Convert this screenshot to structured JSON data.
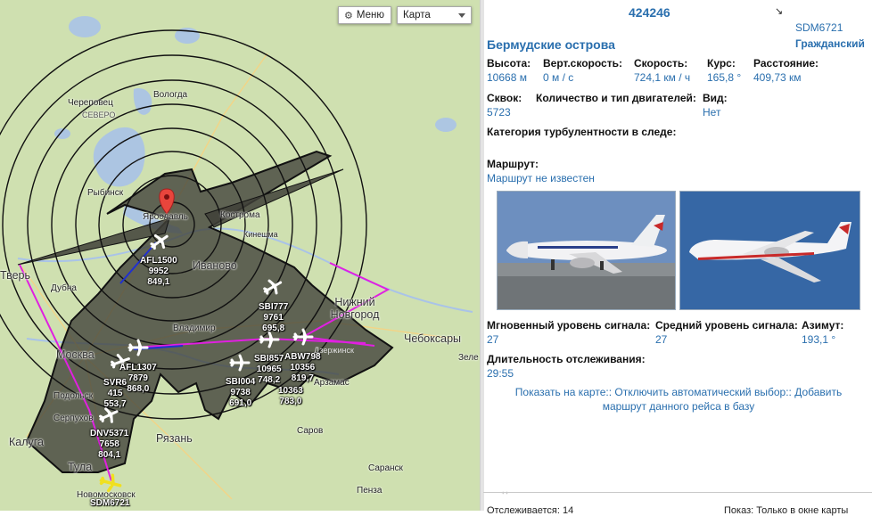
{
  "map": {
    "menu_label": "Меню",
    "layer_value": "Карта",
    "cities": [
      {
        "name": "Вологда",
        "big": false
      },
      {
        "name": "Череповец",
        "big": false
      },
      {
        "name": "СЕВЕРО",
        "big": false
      },
      {
        "name": "Рыбинск",
        "big": false
      },
      {
        "name": "Ярославль",
        "big": false
      },
      {
        "name": "Кострома",
        "big": false
      },
      {
        "name": "Кинешма",
        "big": false
      },
      {
        "name": "Иваново",
        "big": true
      },
      {
        "name": "Тверь",
        "big": true
      },
      {
        "name": "Дубна",
        "big": false
      },
      {
        "name": "Владимир",
        "big": false
      },
      {
        "name": "Нижний Новгород",
        "big": true
      },
      {
        "name": "Чебоксары",
        "big": true
      },
      {
        "name": "Москва",
        "big": true
      },
      {
        "name": "Подольск",
        "big": false
      },
      {
        "name": "Серпухов",
        "big": false
      },
      {
        "name": "Калуга",
        "big": true
      },
      {
        "name": "Тула",
        "big": true
      },
      {
        "name": "Новомосковск",
        "big": false
      },
      {
        "name": "Рязань",
        "big": true
      },
      {
        "name": "Арзамас",
        "big": false
      },
      {
        "name": "Саров",
        "big": false
      },
      {
        "name": "Саранск",
        "big": false
      },
      {
        "name": "Пенза",
        "big": false
      },
      {
        "name": "Зеле",
        "big": false
      },
      {
        "name": "Дзержинск",
        "big": false
      }
    ],
    "flights": [
      {
        "callsign": "AFL1500",
        "altitude": "9952",
        "speed": "849,1"
      },
      {
        "callsign": "SBI777",
        "altitude": "9761",
        "speed": "695,8"
      },
      {
        "callsign": "AFL1307",
        "altitude": "7879",
        "speed": "868,0"
      },
      {
        "callsign": "SVR6",
        "altitude": "415",
        "speed": "553,7"
      },
      {
        "callsign": "SBI857",
        "altitude": "10965",
        "speed": "748,2"
      },
      {
        "callsign": "ABW798",
        "altitude": "10356",
        "speed": "819,7"
      },
      {
        "callsign": "SBI004",
        "altitude": "9738",
        "speed": "691,0"
      },
      {
        "callsign": "",
        "altitude": "10363",
        "speed": "783,0"
      },
      {
        "callsign": "DNV5371",
        "altitude": "7658",
        "speed": "804,1"
      },
      {
        "callsign": "SDM6721",
        "altitude": "",
        "speed": ""
      }
    ],
    "colors": {
      "land": "#cfe0b0",
      "water": "#a9c3e8",
      "coverage": "#3f4038",
      "route": "#e020e0",
      "selected_plane": "#f0e020"
    }
  },
  "panel": {
    "hex_id": "424246",
    "country": "Бермудские острова",
    "callsign": "SDM6721",
    "category": "Гражданский",
    "fields_row1": [
      {
        "label": "Высота:",
        "value": "10668 м"
      },
      {
        "label": "Верт.скорость:",
        "value": "0 м / с"
      },
      {
        "label": "Скорость:",
        "value": "724,1 км / ч"
      },
      {
        "label": "Курс:",
        "value": "165,8 °"
      },
      {
        "label": "Расстояние:",
        "value": "409,73 км"
      }
    ],
    "squawk_label": "Сквок:",
    "squawk_value": "5723",
    "engines_label": "Количество и тип двигателей:",
    "view_label": "Вид:",
    "view_value": "Нет",
    "turbulence_label": "Категория турбулентности в следе:",
    "route_label": "Маршрут:",
    "route_value": "Маршрут не известен",
    "signal_instant_label": "Мгновенный уровень сигнала:",
    "signal_instant_value": "27",
    "signal_avg_label": "Средний уровень сигнала:",
    "signal_avg_value": "27",
    "azimuth_label": "Азимут:",
    "azimuth_value": "193,1 °",
    "tracking_label": "Длительность отслеживания:",
    "tracking_value": "29:55",
    "actions_line1": "Показать на карте:: Отключить автоматический выбор:: Добавить",
    "actions_line2": "маршрут данного рейса в базу",
    "status_left": "Отслеживается: 14",
    "status_right": "Показ: Только в окне карты"
  }
}
